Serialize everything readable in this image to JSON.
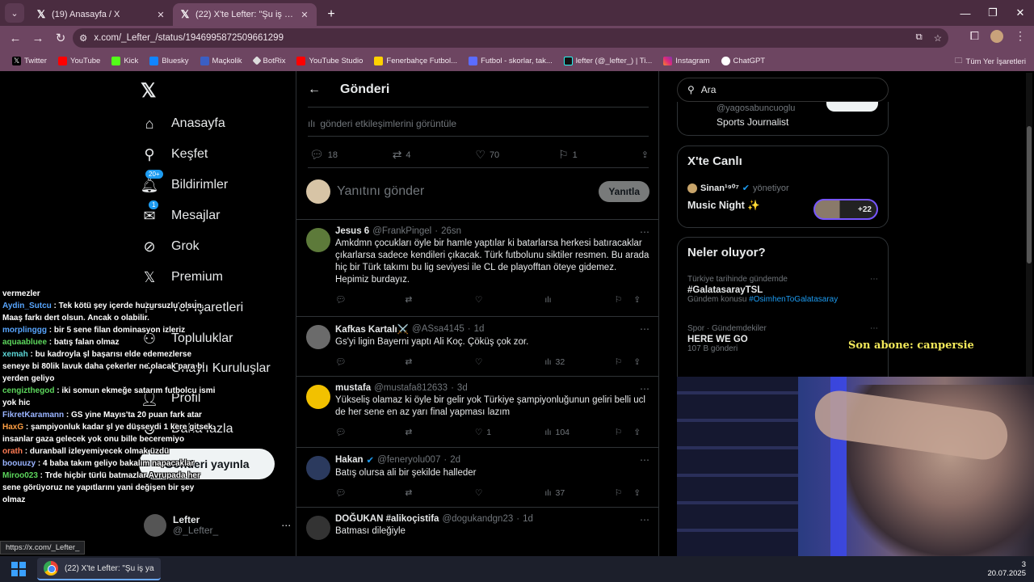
{
  "browser": {
    "tabs": [
      {
        "title": "(19) Anasayfa / X",
        "active": false
      },
      {
        "title": "(22) X'te Lefter: \"Şu iş ya çok fe",
        "active": true
      }
    ],
    "url": "x.com/_Lefter_/status/1946995872509661299",
    "bookmarks": [
      "Twitter",
      "YouTube",
      "Kick",
      "Bluesky",
      "Maçkolik",
      "BotRix",
      "YouTube Studio",
      "Fenerbahçe Futbol...",
      "Futbol - skorlar, tak...",
      "lefter (@_lefter_) | Ti...",
      "Instagram",
      "ChatGPT"
    ],
    "all_bookmarks": "Tüm Yer İşaretleri"
  },
  "leftnav": {
    "items": [
      {
        "label": "Anasayfa",
        "icon": "home-icon"
      },
      {
        "label": "Keşfet",
        "icon": "search-icon"
      },
      {
        "label": "Bildirimler",
        "icon": "bell-icon",
        "badge": "20+"
      },
      {
        "label": "Mesajlar",
        "icon": "mail-icon",
        "badge": "1"
      },
      {
        "label": "Grok",
        "icon": "grok-icon"
      },
      {
        "label": "Premium",
        "icon": "x-icon"
      },
      {
        "label": "Yer İşaretleri",
        "icon": "bookmark-icon"
      },
      {
        "label": "Topluluklar",
        "icon": "people-icon"
      },
      {
        "label": "Onaylı Kuruluşlar",
        "icon": "lightning-icon"
      },
      {
        "label": "Profil",
        "icon": "person-icon"
      },
      {
        "label": "Daha fazla",
        "icon": "more-icon"
      }
    ],
    "post_button": "Gönderi yayınla",
    "account": {
      "name": "Lefter",
      "handle": "@_Lefter_"
    }
  },
  "main": {
    "title": "Gönderi",
    "engagements": "gönderi etkileşimlerini görüntüle",
    "stats": {
      "replies": "18",
      "retweets": "4",
      "likes": "70",
      "bookmarks": "1"
    },
    "reply_placeholder": "Yanıtını gönder",
    "reply_button": "Yanıtla",
    "tweets": [
      {
        "name": "Jesus 6",
        "handle": "@FrankPingel",
        "time": "26sn",
        "text": "Amkdmn çocukları öyle bir hamle yaptılar ki batarlarsa herkesi batıracaklar çıkarlarsa sadece kendileri çıkacak. Türk futbolunu siktiler resmen. Bu arada hiç bir Türk takımı bu lig seviyesi ile CL de playofftan öteye gidemez. Hepimiz burdayız.",
        "replies": "",
        "retweets": "",
        "likes": "",
        "views": ""
      },
      {
        "name": "Kafkas Kartalı⚔️",
        "handle": "@ASsa4145",
        "time": "1d",
        "text": "Gs'yi ligin Bayerni yaptı Ali Koç. Çöküş çok zor.",
        "replies": "",
        "retweets": "",
        "likes": "",
        "views": "32"
      },
      {
        "name": "mustafa",
        "handle": "@mustafa812633",
        "time": "3d",
        "text": "Yükseliş olamaz ki öyle bir gelir yok Türkiye şampiyonluğunun geliri belli ucl de her sene en az yarı final yapması lazım",
        "replies": "",
        "retweets": "",
        "likes": "1",
        "views": "104"
      },
      {
        "name": "Hakan",
        "handle": "@feneryolu007",
        "time": "2d",
        "text": "Batış olursa ali bir şekilde halleder",
        "replies": "",
        "retweets": "",
        "likes": "",
        "views": "37"
      },
      {
        "name": "DOĞUKAN #alikoçistifa",
        "handle": "@dogukandgn23",
        "time": "1d",
        "text": "Batması dileğiyle",
        "replies": "",
        "retweets": "",
        "likes": "",
        "views": ""
      }
    ]
  },
  "right": {
    "search_placeholder": "Ara",
    "prev_card": {
      "handle": "@yagosabuncuoglu",
      "bio": "Sports Journalist"
    },
    "live": {
      "title": "X'te Canlı",
      "host": "Sinan¹⁹⁰⁷",
      "role": "yönetiyor",
      "show": "Music Night ✨",
      "more": "+22"
    },
    "trends_title": "Neler oluyor?",
    "trends": [
      {
        "meta": "Türkiye tarihinde gündemde",
        "name": "#GalatasarayTSL",
        "sub": "Gündem konusu",
        "link": "#OsimhenToGalatasaray"
      },
      {
        "meta": "Spor · Gündemdekiler",
        "name": "HERE WE GO",
        "sub": "107 B gönderi",
        "link": ""
      }
    ]
  },
  "overlay": {
    "subscriber": "Son abone: canpersie",
    "chat": [
      {
        "user": "",
        "color": "#ffffff",
        "msg": "vermezler"
      },
      {
        "user": "Aydin_Sutcu",
        "color": "#58a6ff",
        "msg": "Tek kötü şey içerde huzursuzlu olsun. Maaş farkı dert olsun. Ancak o olabilir."
      },
      {
        "user": "morplinggg",
        "color": "#58a6ff",
        "msg": "bir 5 sene filan dominasyon izleriz"
      },
      {
        "user": "aquaabluee",
        "color": "#5cd65c",
        "msg": "batış falan olmaz"
      },
      {
        "user": "xemah",
        "color": "#5cd6d6",
        "msg": "bu kadroyla şl başarısı elde edemezlerse seneye bi 80lik lavuk daha çekerler ne olacak para bi yerden geliyo"
      },
      {
        "user": "cengizthegod",
        "color": "#5cd65c",
        "msg": "iki somun ekmeğe satarım futbolcu ismi yok hic"
      },
      {
        "user": "FikretKaramann",
        "color": "#9ab4ff",
        "msg": "GS yine Mayıs'ta 20 puan fark atar"
      },
      {
        "user": "HaxG",
        "color": "#ff9f43",
        "msg": "şampiyonluk kadar şl ye düşseydi 1 kere gitsek insanlar gaza gelecek yok onu bille beceremiyo"
      },
      {
        "user": "orath",
        "color": "#ff7b54",
        "msg": "duranball izleyemiyecek olmak üzdü"
      },
      {
        "user": "boouuzy",
        "color": "#9ab4ff",
        "msg": "4 baba takım geliyo bakalım napacaklar"
      },
      {
        "user": "Miroo023",
        "color": "#5cd65c",
        "msg": "Trde hiçbir türlü batmazlar Avrupada her sene görüyoruz ne yapıtlarını yani değişen bir şey olmaz"
      }
    ]
  },
  "statusbar_url": "https://x.com/_Lefter_",
  "taskbar": {
    "app_title": "(22) X'te Lefter: \"Şu iş ya",
    "time": "3",
    "date": "20.07.2025"
  }
}
